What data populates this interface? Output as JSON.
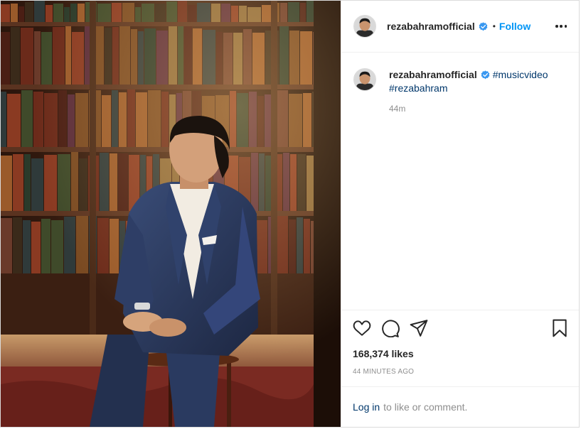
{
  "post": {
    "photo_alt": "Photo by rezabahramofficial",
    "header": {
      "username": "rezabahramofficial",
      "separator": "•",
      "follow_label": "Follow"
    },
    "caption": {
      "username": "rezabahramofficial",
      "hashtag_1": "#musicvideo",
      "hashtag_2": "#rezabahram",
      "time": "44m"
    },
    "actions": {
      "like_icon": "heart-icon",
      "comment_icon": "comment-icon",
      "share_icon": "paper-plane-icon",
      "save_icon": "bookmark-icon"
    },
    "likes_text": "168,374 likes",
    "posted_ago": "44 MINUTES AGO",
    "login": {
      "link_label": "Log in",
      "suffix": "to like or comment."
    }
  },
  "colors": {
    "follow_blue": "#0095f6",
    "link_dark_blue": "#00376b",
    "verified_blue": "#3897f0",
    "muted_gray": "#8e8e8e"
  }
}
